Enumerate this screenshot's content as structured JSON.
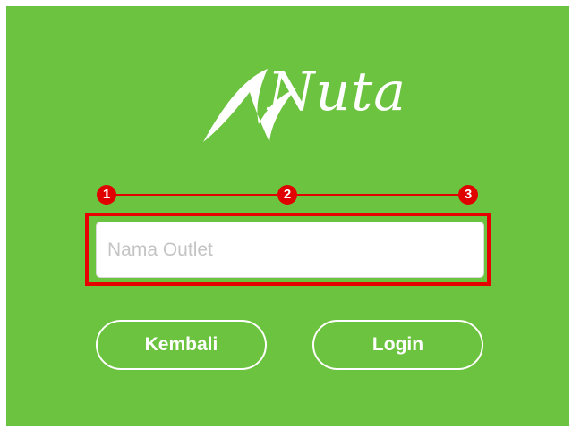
{
  "app": {
    "brand_name": "Nuta",
    "brand_color": "#6cc33f"
  },
  "steps": {
    "labels": [
      "1",
      "2",
      "3"
    ],
    "color": "#e00000"
  },
  "form": {
    "outlet_name": {
      "placeholder": "Nama Outlet",
      "value": ""
    }
  },
  "actions": {
    "back_label": "Kembali",
    "login_label": "Login"
  }
}
